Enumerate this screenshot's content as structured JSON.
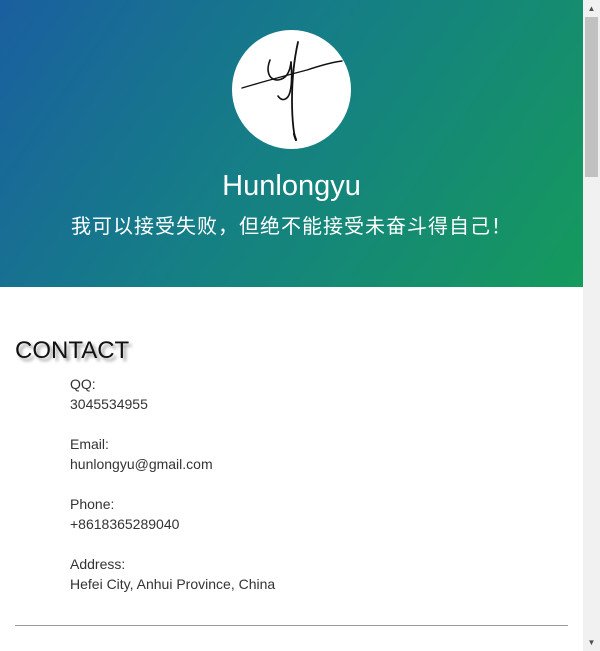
{
  "profile": {
    "name": "Hunlongyu",
    "motto": "我可以接受失败，但绝不能接受未奋斗得自己！"
  },
  "contact": {
    "title": "CONTACT",
    "items": [
      {
        "label": "QQ:",
        "value": "3045534955"
      },
      {
        "label": "Email:",
        "value": "hunlongyu@gmail.com"
      },
      {
        "label": "Phone:",
        "value": "+8618365289040"
      },
      {
        "label": "Address:",
        "value": "Hefei City, Anhui Province, China"
      }
    ]
  },
  "theme": {
    "hero_gradient_start": "#1a5fa0",
    "hero_gradient_end": "#159a5c",
    "text": "#333333"
  },
  "icons": {
    "avatar": "signature-logo",
    "scroll_up": "up-arrow-icon",
    "scroll_down": "down-arrow-icon"
  }
}
